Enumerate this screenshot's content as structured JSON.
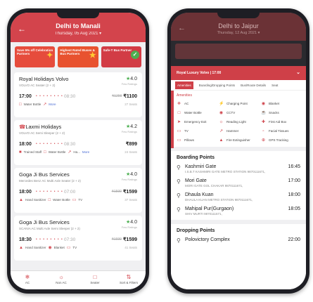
{
  "left": {
    "header": {
      "title": "Delhi to Manali",
      "date": "Thursday, 05 Aug 2021 ▾"
    },
    "promos": [
      {
        "text": "Save 5% off Celebration Partners",
        "icon": "gift-icon"
      },
      {
        "text": "Highest Rated Buses & Bus Partners",
        "icon": "star-icon"
      },
      {
        "text": "Safe-T Bus Partner",
        "icon": "check-icon"
      }
    ],
    "buses": [
      {
        "name": "Royal Holidays Volvo",
        "type": "VOLVO AC Seater (2 + 2)",
        "rating": "4.0",
        "rating_sub": "Few Ratings",
        "dep": "17:00",
        "arr": "08:30",
        "old_price": "₹1299",
        "price": "₹1100",
        "features": [
          "Water Bottle",
          "More"
        ],
        "seats": "27 Seats"
      },
      {
        "name": "Laxmi Holidays",
        "type": "VOLVO AC Semi Sleeper (2 + 2)",
        "rating": "4.2",
        "rating_sub": "Few Ratings",
        "dep": "18:00",
        "arr": "08:30",
        "old_price": "",
        "price": "₹899",
        "features": [
          "Trained Staff",
          "Water Bottle",
          "Ha..."
        ],
        "more": "More",
        "seats": "24 Seats"
      },
      {
        "name": "Goga Ji Bus Services",
        "type": "Mercedes Benz AC Multi Axle Seater (2 + 2)",
        "rating": "4.0",
        "rating_sub": "Few Ratings",
        "dep": "18:00",
        "arr": "07:00",
        "old_price": "₹1599",
        "price": "₹1599",
        "features": [
          "Hand Sanitizer",
          "Water Bottle",
          "TV"
        ],
        "seats": "37 Seats"
      },
      {
        "name": "Goga Ji Bus Services",
        "type": "SCANIA AC Multi Axle Semi Sleeper (2 + 2)",
        "rating": "4.0",
        "rating_sub": "Few Ratings",
        "dep": "18:30",
        "arr": "07:30",
        "old_price": "₹1699",
        "price": "₹1599",
        "features": [
          "Hand Sanitizer",
          "Blanket",
          "TV"
        ],
        "seats": "41 Seats"
      }
    ],
    "bottom": [
      "AC",
      "Non AC",
      "Seater",
      "Sort & Filters"
    ]
  },
  "right": {
    "header": {
      "title": "Delhi to Jaipur",
      "date": "Thursday, 12 Aug 2021 ▾"
    },
    "sheet_title": "Royal Luxury Volvo | 17:00",
    "tabs": [
      "Amenities",
      "Boarding/Dropping Points",
      "Bus/Route Details",
      "Seat"
    ],
    "amenities_title": "Amenities",
    "amenities": [
      "AC",
      "Charging Point",
      "Blanket",
      "Water Bottle",
      "CCTV",
      "Snacks",
      "Emergency Exit",
      "Reading Light",
      "First Aid Box",
      "TV",
      "Hammer",
      "Facial Tissues",
      "Pillows",
      "Fire Extinguisher",
      "GPS Tracking"
    ],
    "boarding_title": "Boarding Points",
    "boarding": [
      {
        "name": "Kashmiri Gate",
        "addr": "I.S.B.T KASHMIRI GATE METRO STATION  9870111671,",
        "time": "16:45"
      },
      {
        "name": "Mori Gate",
        "addr": "MORI GATE GOL CHAKAR  9870111671,",
        "time": "17:00"
      },
      {
        "name": "Dhaula Kuan",
        "addr": "DHAULA KUAN METRO STATION 9870111671,",
        "time": "18:00"
      },
      {
        "name": "Mahipal Pur(Gurgaon)",
        "addr": "SHIV MURTI  9870111671,",
        "time": "18:05"
      }
    ],
    "dropping_title": "Dropping Points",
    "dropping": [
      {
        "name": "Polovictory Complex",
        "time": "22:00"
      }
    ]
  }
}
